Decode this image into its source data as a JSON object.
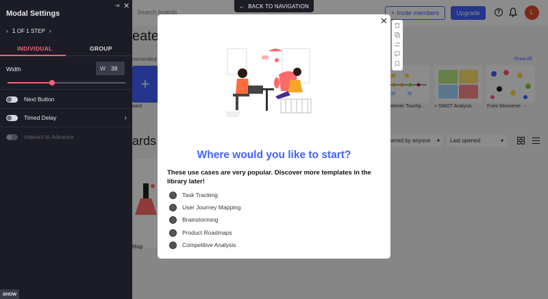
{
  "app": {
    "search_placeholder": "Search boards",
    "invite_label": "Invite members",
    "upgrade_label": "Upgrade",
    "avatar_initial": "L",
    "create_title": "eate",
    "recommended_label": "mmended",
    "show_all": "Show All",
    "tile_labels": [
      "oard",
      "ustomer Touchp...",
      "+ SWOT Analysis",
      "From Miroverse →"
    ],
    "boards_title": "ards",
    "owned_filter": "wned by anyone",
    "sort_filter": "Last opened",
    "map_label": "Map"
  },
  "panel": {
    "title": "Modal Settings",
    "step_current": "1",
    "step_text": "OF 1 STEP",
    "tab_individual": "INDIVIDUAL",
    "tab_group": "GROUP",
    "width_label": "Width",
    "width_prefix": "W",
    "width_value": "38",
    "width_slider_fraction": 0.38,
    "next_button": "Next Button",
    "timed_delay": "Timed Delay",
    "interact_advance": "Interact to Advance",
    "show_label": "SHOW"
  },
  "back_nav_label": "BACK TO NAVIGATION",
  "modal": {
    "title": "Where would you like to start?",
    "subtitle": "These use cases are very popular. Discover more templates in the library later!",
    "options": [
      "Task Tracking",
      "User Journey Mapping",
      "Brainstorming",
      "Product Roadmaps",
      "Competitive Analysis"
    ]
  },
  "colors": {
    "accent_blue": "#4262ff",
    "panel_bg": "#1b1c25",
    "accent_pink": "#ff5f7a"
  }
}
